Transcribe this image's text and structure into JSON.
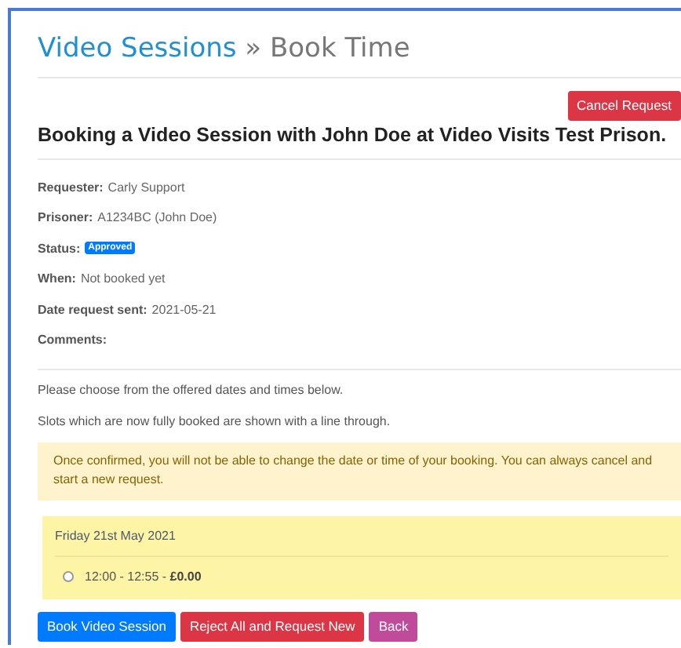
{
  "breadcrumb": {
    "link": "Video Sessions",
    "separator": "»",
    "current": "Book Time"
  },
  "cancel_button": "Cancel Request",
  "heading": "Booking a Video Session with John Doe at Video Visits Test Prison.",
  "details": [
    {
      "kind": "text",
      "label": "Requester:",
      "value": "Carly Support"
    },
    {
      "kind": "text",
      "label": "Prisoner:",
      "value": "A1234BC (John Doe)"
    },
    {
      "kind": "badge",
      "label": "Status:",
      "value": "Approved"
    },
    {
      "kind": "text",
      "label": "When:",
      "value": "Not booked yet"
    },
    {
      "kind": "text",
      "label": "Date request sent:",
      "value": "2021-05-21"
    },
    {
      "kind": "text",
      "label": "Comments:"
    }
  ],
  "instructions": [
    "Please choose from the offered dates and times below.",
    "Slots which are now fully booked are shown with a line through."
  ],
  "warning": "Once confirmed, you will not be able to change the date or time of your booking. You can always cancel and start a new request.",
  "days": [
    {
      "date": "Friday 21st May 2021",
      "slots": [
        {
          "label": "12:00 - 12:55 - **£0.00**",
          "selected": false
        }
      ]
    }
  ],
  "buttons": [
    {
      "kind": "primary",
      "label": "Book Video Session"
    },
    {
      "kind": "danger",
      "label": "Reject All and Request New"
    },
    {
      "kind": "purple",
      "label": "Back"
    }
  ]
}
